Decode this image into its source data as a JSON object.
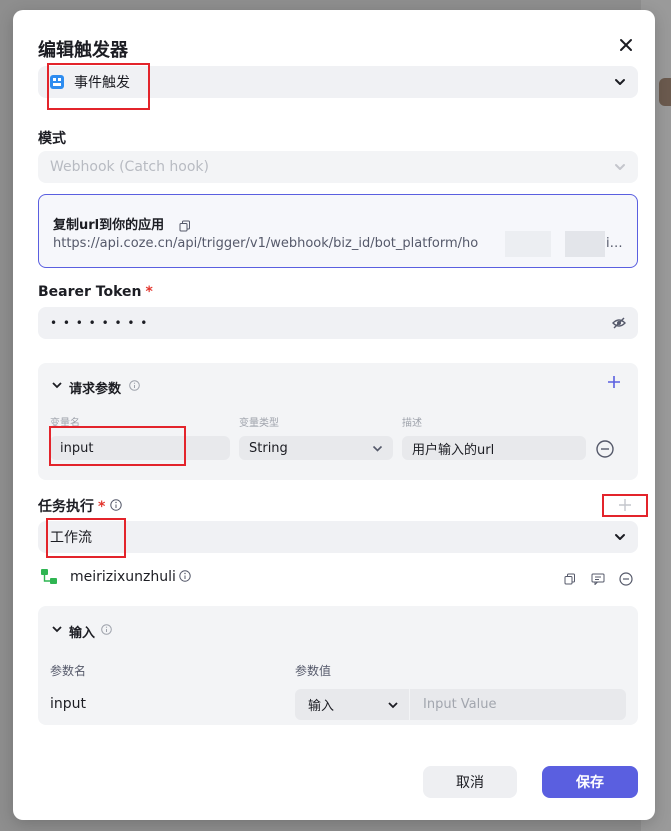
{
  "dialog": {
    "title": "编辑触发器"
  },
  "trigger_type": {
    "selected": "事件触发"
  },
  "mode": {
    "label": "模式",
    "selected": "Webhook (Catch hook)"
  },
  "url_box": {
    "title": "复制url到你的应用",
    "url": "https://api.coze.cn/api/trigger/v1/webhook/biz_id/bot_platform/ho",
    "url_tail": "i…"
  },
  "bearer": {
    "label": "Bearer Token",
    "required_mark": "*",
    "value": "• • • • • • • •"
  },
  "request_params": {
    "title": "请求参数",
    "columns": [
      "变量名",
      "变量类型",
      "描述"
    ],
    "rows": [
      {
        "name": "input",
        "type": "String",
        "description": "用户输入的url"
      }
    ]
  },
  "task": {
    "label": "任务执行",
    "required_mark": "*",
    "selected": "工作流",
    "workflow_name": "meirizixunzhuli"
  },
  "inputs": {
    "title": "输入",
    "columns": [
      "参数名",
      "参数值"
    ],
    "rows": [
      {
        "name": "input",
        "source": "输入",
        "placeholder": "Input Value"
      }
    ]
  },
  "footer": {
    "cancel_label": "取消",
    "save_label": "保存"
  },
  "colors": {
    "accent": "#5a5fe0",
    "required": "#e3352d",
    "annotation": "#e3242b"
  }
}
